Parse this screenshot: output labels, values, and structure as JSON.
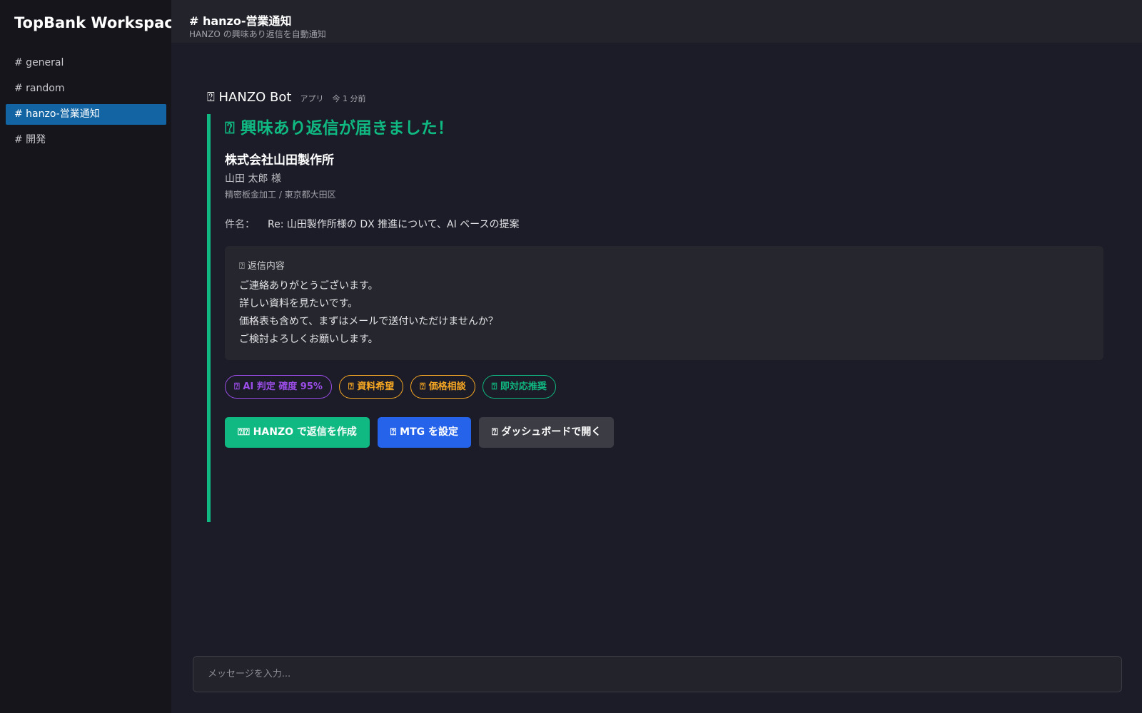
{
  "sidebar": {
    "workspace": "TopBank Workspace",
    "channels": [
      {
        "label": "# general",
        "active": false
      },
      {
        "label": "# random",
        "active": false
      },
      {
        "label": "# hanzo-営業通知",
        "active": true
      },
      {
        "label": "# 開発",
        "active": false
      }
    ]
  },
  "topbar": {
    "title": "# hanzo-営業通知",
    "subtitle": "HANZO の興味あり返信を自動通知"
  },
  "message": {
    "bot_name": "⍰ HANZO Bot",
    "bot_tag": "アプリ",
    "time": "今 1 分前",
    "headline": "⍰ 興味あり返信が届きました！",
    "company": "株式会社山田製作所",
    "person": "山田 太郎 様",
    "industry": "精密板金加工 / 東京都大田区",
    "subject_label": "件名：",
    "subject_value": "Re: 山田製作所様の DX 推進について、AI ベースの提案",
    "reply_label": "⍰ 返信内容",
    "reply_lines": [
      "ご連絡ありがとうございます。",
      "詳しい資料を見たいです。",
      "価格表も含めて、まずはメールで送付いただけませんか？",
      "ご検討よろしくお願いします。"
    ],
    "tags": [
      {
        "label": "⍰ AI 判定 確度 95%",
        "color": "#9b4de8"
      },
      {
        "label": "⍰ 資料希望",
        "color": "#f5a623"
      },
      {
        "label": "⍰ 価格相談",
        "color": "#f5a623"
      },
      {
        "label": "⍰ 即対応推奨",
        "color": "#10b981"
      }
    ],
    "actions": [
      {
        "label": "⍰⍰ HANZO で返信を作成",
        "color": "#10b981"
      },
      {
        "label": "⍰ MTG を設定",
        "color": "#2563eb"
      },
      {
        "label": "⍰ ダッシュボードで開く",
        "color": "#3b3c44"
      }
    ]
  },
  "composer": {
    "placeholder": "メッセージを入力..."
  },
  "colors": {
    "accent_green": "#10b981",
    "active_channel": "#1264a3",
    "sidebar_bg": "#16151c",
    "main_bg": "#1b1c27"
  }
}
